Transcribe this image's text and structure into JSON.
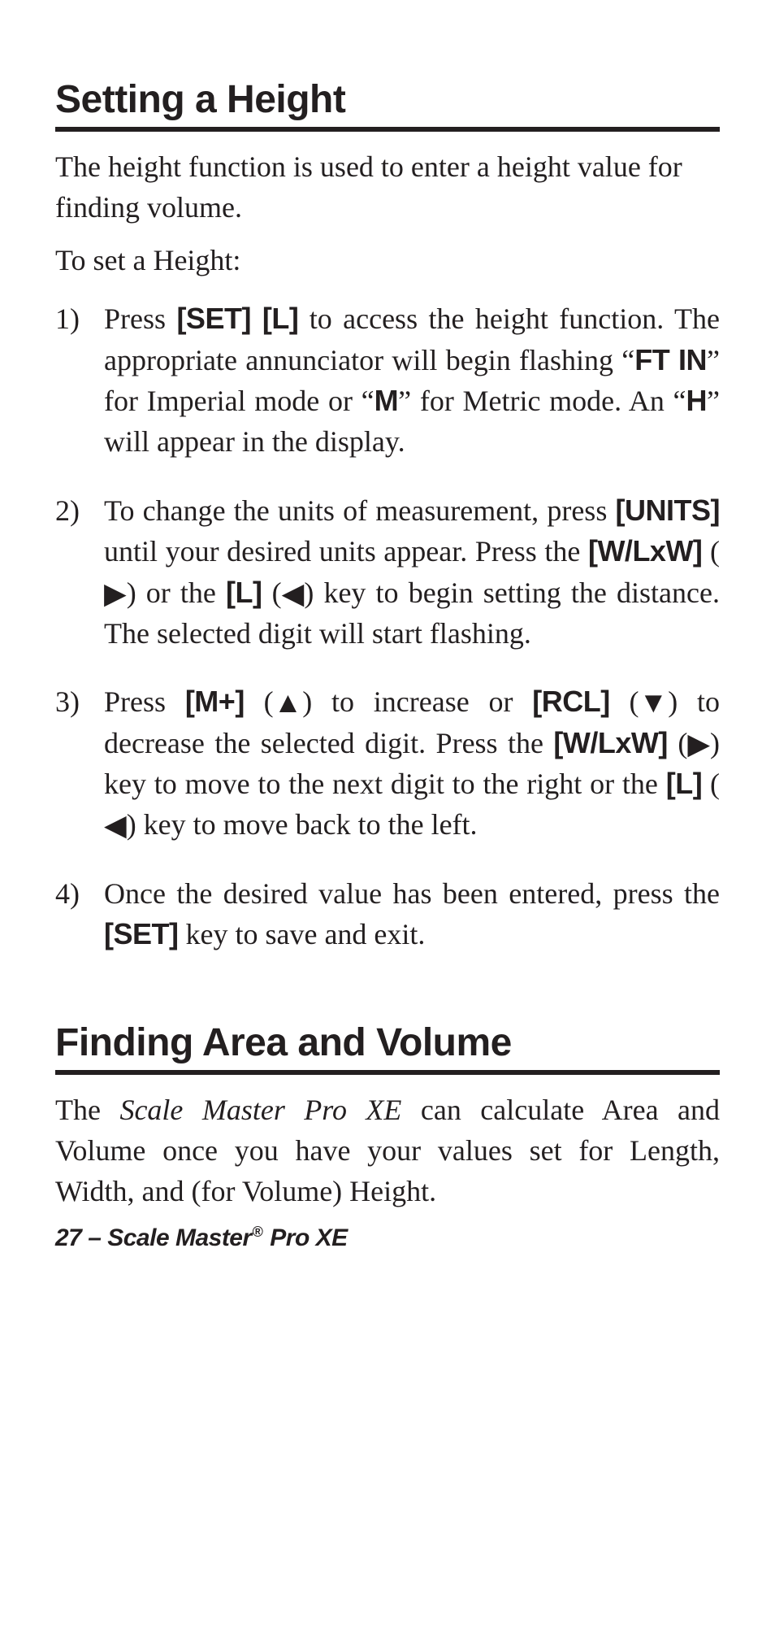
{
  "section1": {
    "title": "Setting a Height",
    "intro": "The height function is used to enter a height value for finding volume.",
    "sub_intro": "To set a Height:"
  },
  "steps": {
    "s1": {
      "num": "1)",
      "t1": "Press ",
      "k1": "[SET] [L]",
      "t2": " to access the height function. The appropriate annunciator will begin flashing “",
      "a1": "FT IN",
      "t3": "” for Imperial mode or “",
      "a2": "M",
      "t4": "” for Metric mode. An “",
      "a3": "H",
      "t5": "” will appear in the display."
    },
    "s2": {
      "num": "2)",
      "t1": "To change the units of measurement, press ",
      "k1": "[UNITS]",
      "t2": " until your desired units appear. Press the ",
      "k2": "[W/LxW]",
      "t3": " (",
      "ar1": "▶",
      "t4": ") or the ",
      "k3": "[L]",
      "t5": " (",
      "ar2": "◀",
      "t6": ") key to begin setting the distance. The selected digit will start flashing."
    },
    "s3": {
      "num": "3)",
      "t1": "Press ",
      "k1": "[M+]",
      "t2": " (",
      "ar1": "▲",
      "t3": ") to increase or ",
      "k2": "[RCL]",
      "t4": " (",
      "ar2": "▼",
      "t5": ") to decrease the selected digit. Press the ",
      "k3": "[W/LxW]",
      "t6": " (",
      "ar3": "▶",
      "t7": ") key to move to the next digit to the right or the ",
      "k4": "[L]",
      "t8": " (",
      "ar4": "◀",
      "t9": ") key to move back to the left."
    },
    "s4": {
      "num": "4)",
      "t1": "Once the desired value has been entered, press the ",
      "k1": "[SET]",
      "t2": " key to save and exit."
    }
  },
  "section2": {
    "title": "Finding Area and Volume",
    "p_t1": "The ",
    "p_italic": "Scale Master Pro XE",
    "p_t2": " can calculate Area and Volume once you have your values set for Length, Width, and (for Volume) Height."
  },
  "footer": {
    "t1": "27 – Scale Master",
    "reg": "®",
    "t2": " Pro XE"
  }
}
